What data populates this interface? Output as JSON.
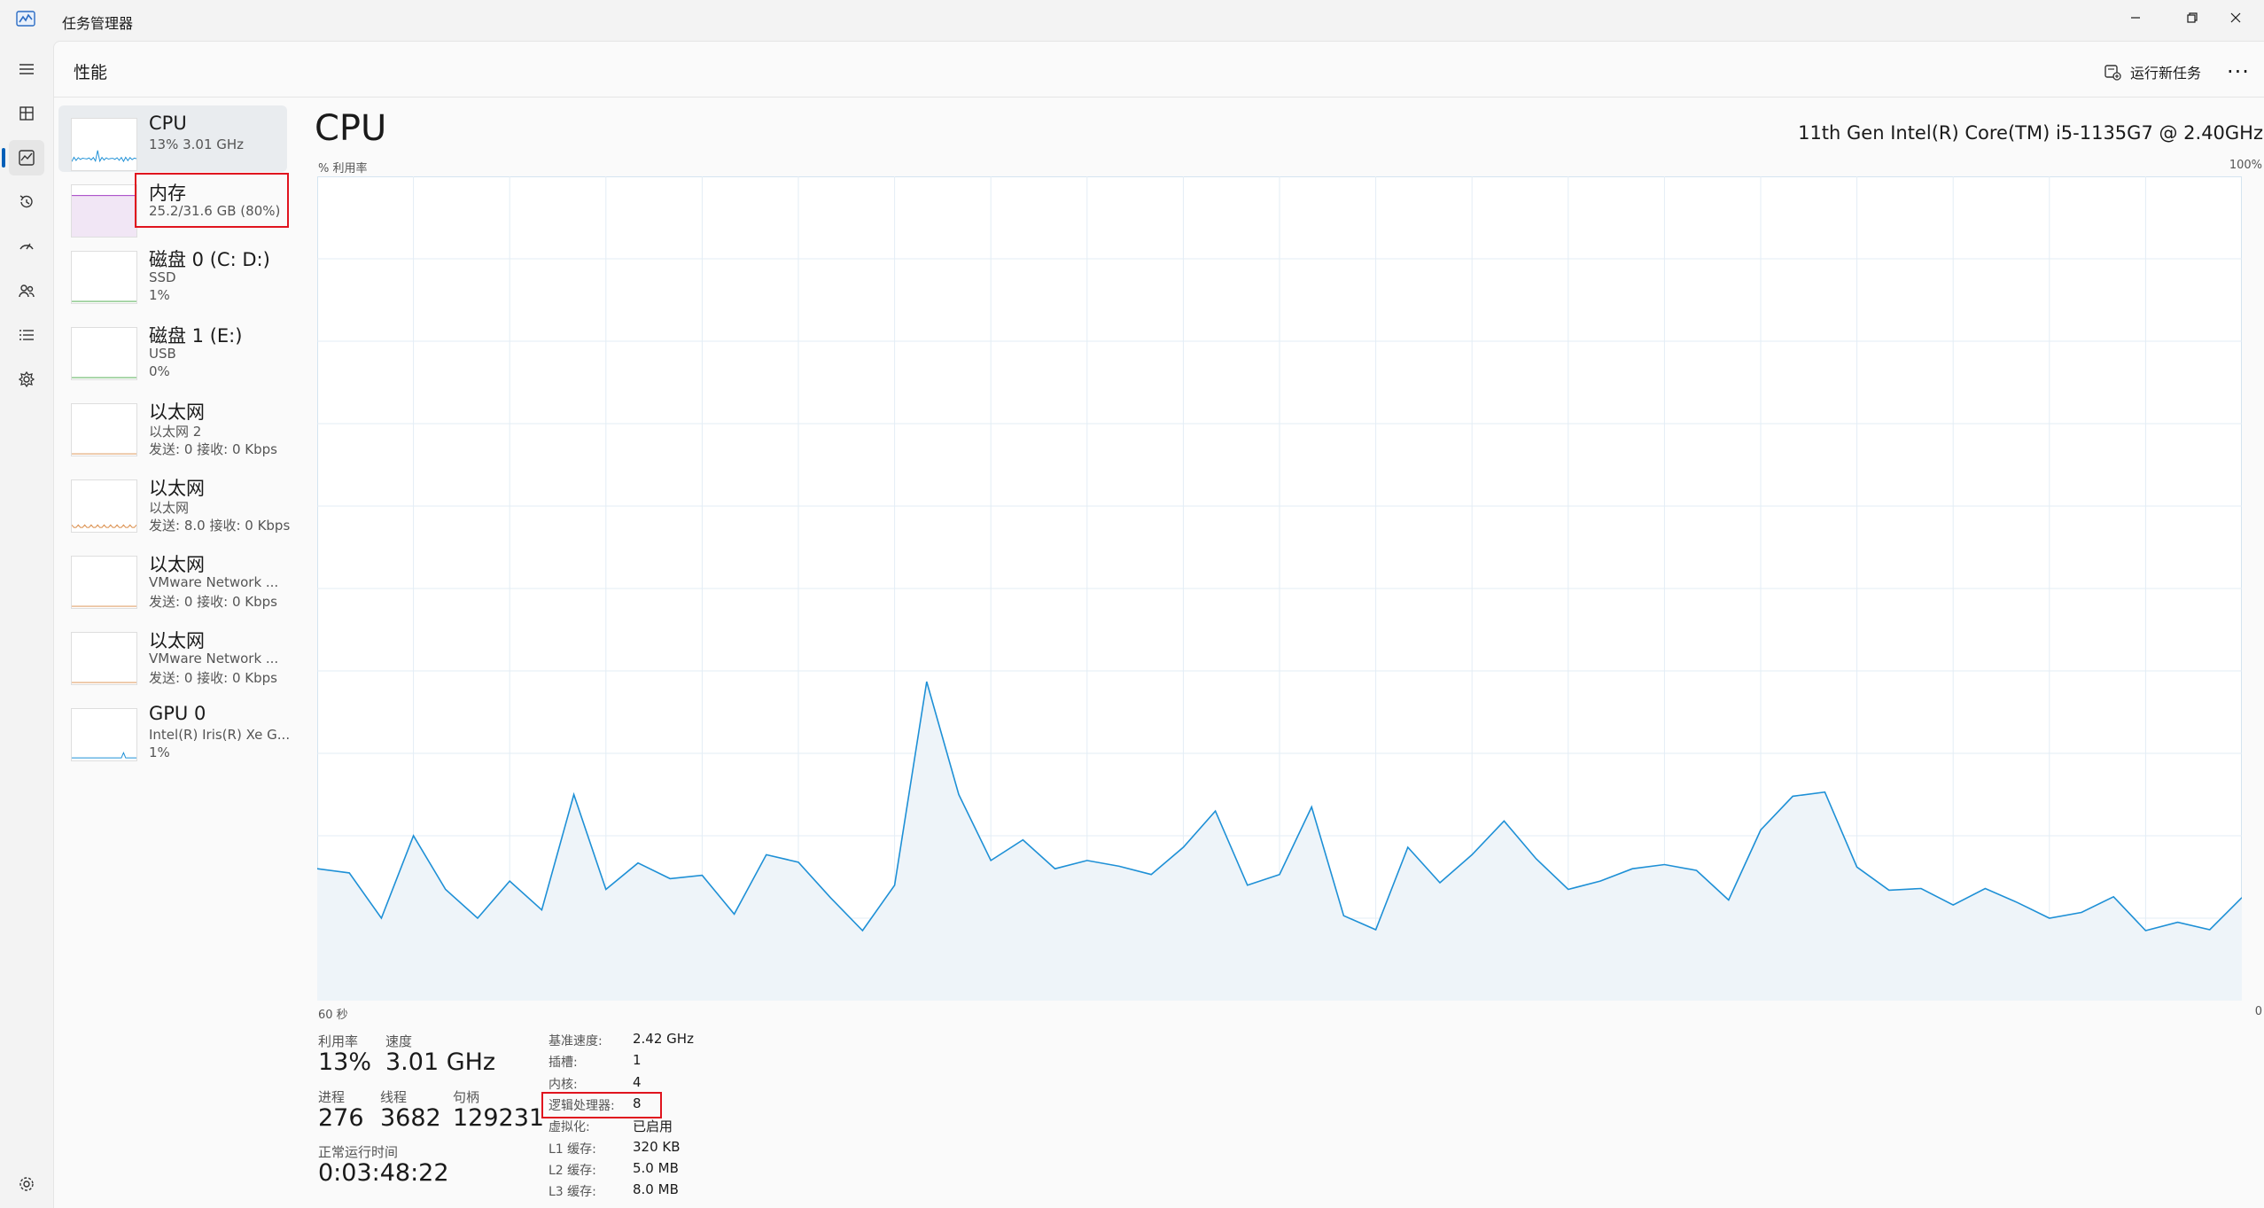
{
  "window": {
    "title": "任务管理器"
  },
  "page": {
    "title": "性能",
    "run_new_task": "运行新任务",
    "more": "···"
  },
  "nav": [
    {
      "icon": "hamburger-menu-icon"
    },
    {
      "icon": "processes-icon"
    },
    {
      "icon": "performance-icon",
      "active": true
    },
    {
      "icon": "app-history-icon"
    },
    {
      "icon": "startup-apps-icon"
    },
    {
      "icon": "users-icon"
    },
    {
      "icon": "details-icon"
    },
    {
      "icon": "services-icon"
    },
    {
      "icon": "settings-icon"
    }
  ],
  "sidebar": {
    "items": [
      {
        "title": "CPU",
        "sub1": "13% 3.01 GHz",
        "color": "#1e90d6",
        "selected": true,
        "highlighted": false
      },
      {
        "title": "内存",
        "sub1": "25.2/31.6 GB (80%)",
        "color": "#a23ec4",
        "selected": false,
        "highlighted": true
      },
      {
        "title": "磁盘 0 (C: D:)",
        "sub1": "SSD",
        "sub2": "1%",
        "color": "#3da33d"
      },
      {
        "title": "磁盘 1 (E:)",
        "sub1": "USB",
        "sub2": "0%",
        "color": "#3da33d"
      },
      {
        "title": "以太网",
        "sub1": "以太网 2",
        "sub2": "发送: 0 接收: 0 Kbps",
        "color": "#d98a45"
      },
      {
        "title": "以太网",
        "sub1": "以太网",
        "sub2": "发送: 8.0 接收: 0 Kbps",
        "color": "#d98a45"
      },
      {
        "title": "以太网",
        "sub1": "VMware Network ...",
        "sub2": "发送: 0 接收: 0 Kbps",
        "color": "#d98a45"
      },
      {
        "title": "以太网",
        "sub1": "VMware Network ...",
        "sub2": "发送: 0 接收: 0 Kbps",
        "color": "#d98a45"
      },
      {
        "title": "GPU 0",
        "sub1": "Intel(R) Iris(R) Xe G...",
        "sub2": "1%",
        "color": "#1e90d6"
      }
    ]
  },
  "detail": {
    "title": "CPU",
    "model": "11th Gen Intel(R) Core(TM) i5-1135G7 @ 2.40GHz",
    "y_label": "% 利用率",
    "y_max": "100%",
    "x_left": "60 秒",
    "x_right": "0"
  },
  "chart_data": {
    "type": "area",
    "ylabel": "% 利用率",
    "ylim": [
      0,
      100
    ],
    "xlim": [
      60,
      0
    ],
    "grid": true,
    "color": "#1e90d6",
    "values": [
      16,
      15.5,
      10,
      20,
      13.5,
      10,
      14.5,
      11,
      25,
      13.5,
      16.7,
      14.8,
      15.2,
      10.5,
      17.7,
      16.8,
      12.5,
      8.5,
      14,
      38.7,
      25,
      17,
      19.5,
      16,
      17,
      16.3,
      15.3,
      18.6,
      23,
      14,
      15.3,
      23.5,
      10.3,
      8.6,
      18.6,
      14.3,
      17.7,
      21.8,
      17.2,
      13.5,
      14.5,
      16,
      16.5,
      15.8,
      12.2,
      20.7,
      24.8,
      25.3,
      16.2,
      13.4,
      13.6,
      11.6,
      13.6,
      11.9,
      10,
      10.7,
      12.6,
      8.5,
      9.5,
      8.6,
      12.5
    ]
  },
  "stats": {
    "utilization_label": "利用率",
    "utilization": "13%",
    "speed_label": "速度",
    "speed": "3.01 GHz",
    "processes_label": "进程",
    "processes": "276",
    "threads_label": "线程",
    "threads": "3682",
    "handles_label": "句柄",
    "handles": "129231",
    "uptime_label": "正常运行时间",
    "uptime": "0:03:48:22"
  },
  "specs": [
    {
      "label": "基准速度:",
      "value": "2.42 GHz"
    },
    {
      "label": "插槽:",
      "value": "1"
    },
    {
      "label": "内核:",
      "value": "4"
    },
    {
      "label": "逻辑处理器:",
      "value": "8"
    },
    {
      "label": "虚拟化:",
      "value": "已启用"
    },
    {
      "label": "L1 缓存:",
      "value": "320 KB"
    },
    {
      "label": "L2 缓存:",
      "value": "5.0 MB"
    },
    {
      "label": "L3 缓存:",
      "value": "8.0 MB"
    }
  ]
}
